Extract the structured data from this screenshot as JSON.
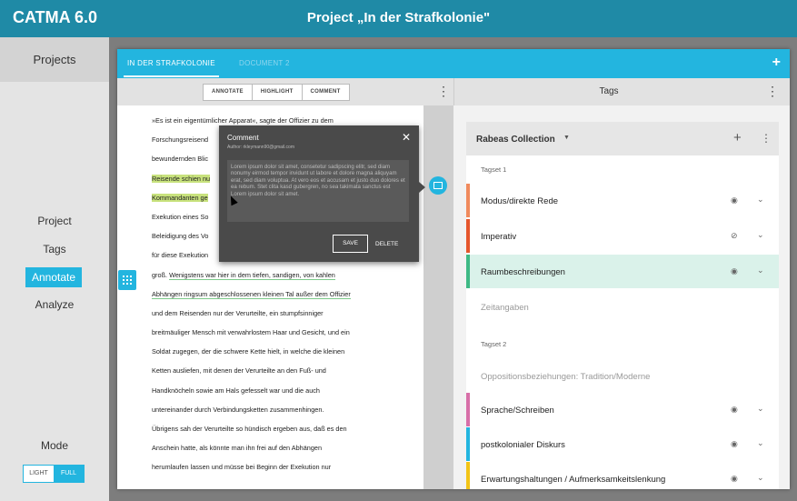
{
  "app": {
    "title": "CATMA 6.0"
  },
  "project": {
    "title": "Project „In der Strafkolonie\""
  },
  "sidebar": {
    "projects": "Projects",
    "items": [
      {
        "label": "Project"
      },
      {
        "label": "Tags"
      },
      {
        "label": "Annotate",
        "active": true
      },
      {
        "label": "Analyze"
      }
    ],
    "mode_label": "Mode",
    "mode_options": [
      "LIGHT",
      "FULL"
    ],
    "mode_selected": "FULL"
  },
  "tabs": [
    {
      "label": "IN DER STRAFKOLONIE",
      "active": true
    },
    {
      "label": "DOCUMENT 2",
      "active": false
    }
  ],
  "toolbar": {
    "annotate": "ANNOTATE",
    "highlight": "HIGHLIGHT",
    "comment": "COMMENT"
  },
  "document": {
    "lines": [
      "»Es ist ein eigentümlicher Apparat«, sagte der Offizier zu dem",
      "Forschungsreisend",
      "bewundernden Blic",
      "Reisende schien nu",
      "Kommandanten ge",
      "Exekution eines So",
      "Beleidigung des Vo",
      "für diese Exekution",
      "groß. Wenigstens war hier in dem tiefen, sandigen, von kahlen",
      "Abhängen ringsum abgeschlossenen kleinen Tal außer dem Offizier",
      "und dem Reisenden nur der Verurteilte, ein stumpfsinniger",
      "breitmäuliger Mensch mit verwahrlostem Haar und Gesicht, und ein",
      "Soldat zugegen, der die schwere Kette hielt, in welche die kleinen",
      "Ketten ausliefen, mit denen der Verurteilte an den Fuß- und",
      "Handknöcheln sowie am Hals gefesselt war und die auch",
      "untereinander durch Verbindungsketten zusammenhingen.",
      "Übrigens sah der Verurteilte so hündisch ergeben aus, daß es den",
      "Anschein hatte, als könnte man ihn frei auf den Abhängen",
      "herumlaufen lassen und müsse bei Beginn der Exekution nur"
    ],
    "line9_prefix": "groß. ",
    "line9_underlined": "Wenigstens war hier in dem tiefen, sandigen, von kahlen"
  },
  "comment": {
    "title": "Comment",
    "author": "Author: rkleymann90@gmail.com",
    "body": "Lorem ipsum dolor sit amet, consetetur sadipscing elitr, sed diam nonumy eirmod tempor invidunt ut labore et dolore magna aliquyam erat, sed diam voluptua. At vero eos et accusam et justo duo dolores et ea rebum. Stet clita kasd gubergren, no sea takimata sanctus est Lorem ipsum dolor sit amet.",
    "save": "SAVE",
    "delete": "DELETE"
  },
  "tags": {
    "header": "Tags",
    "collection": "Rabeas Collection",
    "tagsets": [
      {
        "name": "Tagset 1",
        "tags": [
          {
            "name": "Modus/direkte Rede",
            "color": "#f08a5d",
            "visible": true
          },
          {
            "name": "Imperativ",
            "color": "#e5562c",
            "visible": false
          },
          {
            "name": "Raumbeschreibungen",
            "color": "#3fb985",
            "visible": true,
            "selected": true
          },
          {
            "name": "Zeitangaben",
            "color": "",
            "dim": true
          }
        ]
      },
      {
        "name": "Tagset 2",
        "tags": [
          {
            "name": "Oppositionsbeziehungen: Tradition/Moderne",
            "color": "",
            "dim": true
          },
          {
            "name": "Sprache/Schreiben",
            "color": "#d86fa8",
            "visible": true
          },
          {
            "name": "postkolonialer Diskurs",
            "color": "#23b5df",
            "visible": true
          },
          {
            "name": "Erwartungshaltungen / Aufmerksamkeitslenkung",
            "color": "#f2c417",
            "visible": true
          }
        ]
      }
    ]
  },
  "icons": {
    "add": "+",
    "menu": "⋮",
    "close": "✕",
    "caret": "▼",
    "eye": "👁",
    "chevron": "⌄"
  }
}
